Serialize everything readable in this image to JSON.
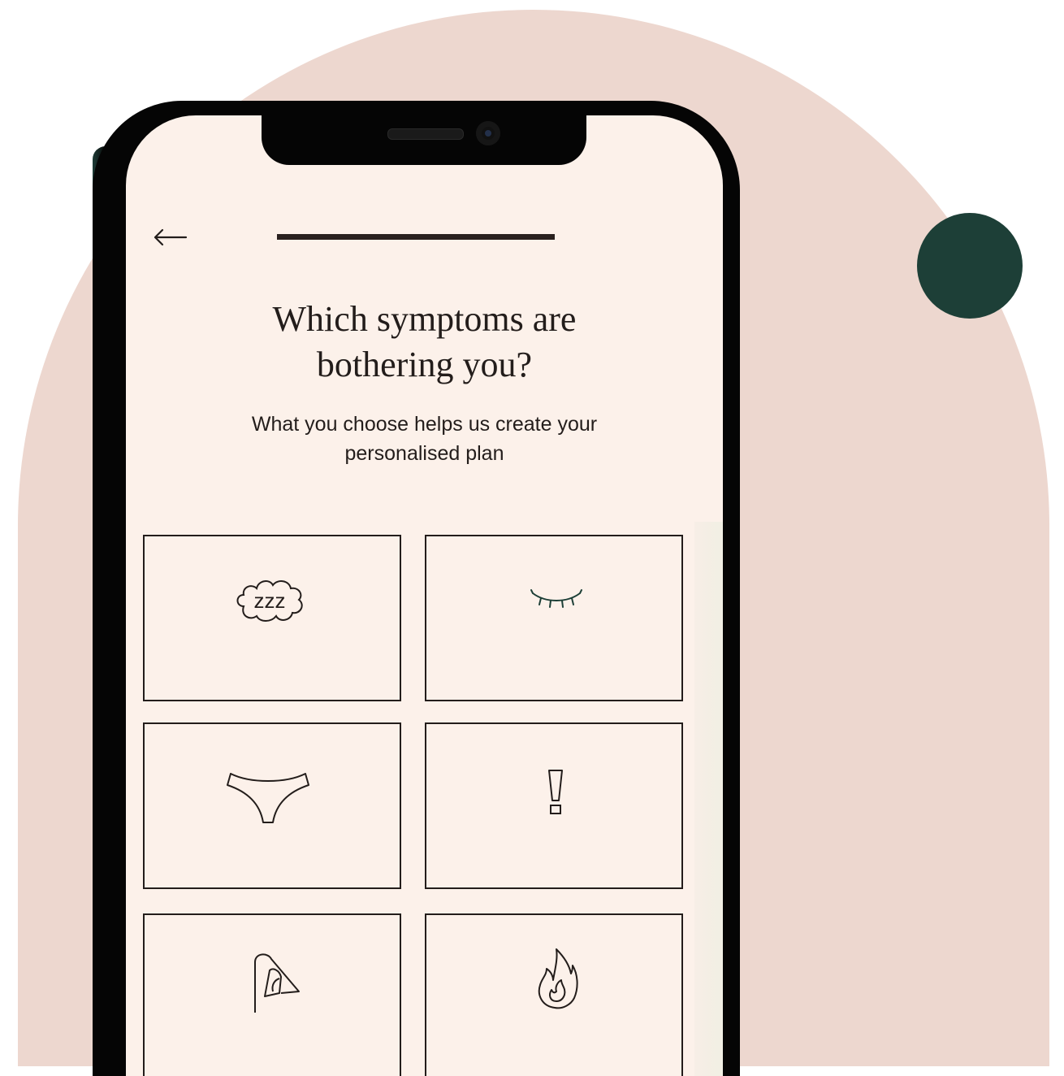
{
  "colors": {
    "background_arch": "#edd7cf",
    "accent_dot": "#1d3f37",
    "screen_bg": "#fcf1ea",
    "text": "#231d1b"
  },
  "header": {
    "back_icon": "arrow-left-icon",
    "progress": 1.0
  },
  "question": {
    "title_line1": "Which symptoms are",
    "title_line2": "bothering you?",
    "subtitle": "What you choose helps us create your personalised plan"
  },
  "options": [
    {
      "icon": "sleep-zzz-icon"
    },
    {
      "icon": "closed-eye-icon"
    },
    {
      "icon": "underwear-icon"
    },
    {
      "icon": "exclamation-icon"
    },
    {
      "icon": "bladder-icon"
    },
    {
      "icon": "flame-icon"
    }
  ]
}
